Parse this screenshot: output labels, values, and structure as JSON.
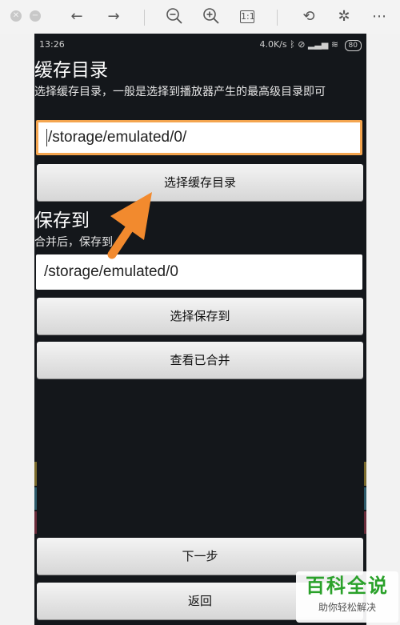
{
  "viewer_toolbar": {
    "icons": [
      "close-icon",
      "minimize-icon",
      "back-arrow-icon",
      "forward-arrow-icon",
      "zoom-out-icon",
      "zoom-in-icon",
      "actual-size-icon",
      "rotate-icon",
      "magic-wand-icon",
      "more-icon"
    ],
    "actual_size_label": "1:1"
  },
  "status_bar": {
    "time": "13:26",
    "network_speed": "4.0K/s",
    "battery": "80"
  },
  "cache_section": {
    "title": "缓存目录",
    "description": "选择缓存目录，一般是选择到播放器产生的最高级目录即可",
    "path_value": "/storage/emulated/0/",
    "button_label": "选择缓存目录"
  },
  "save_section": {
    "title": "保存到",
    "description": "合并后，保存到",
    "path_value": "/storage/emulated/0",
    "button_label": "选择保存到",
    "view_merged_label": "查看已合并"
  },
  "footer": {
    "next_label": "下一步",
    "back_label": "返回"
  },
  "watermark": {
    "title": "百科全说",
    "subtitle": "助你轻松解决"
  },
  "colors": {
    "accent_orange": "#f28a2e",
    "input_focus_border": "#f4a54f",
    "app_background": "#14171b",
    "watermark_green": "#2aa12a"
  }
}
